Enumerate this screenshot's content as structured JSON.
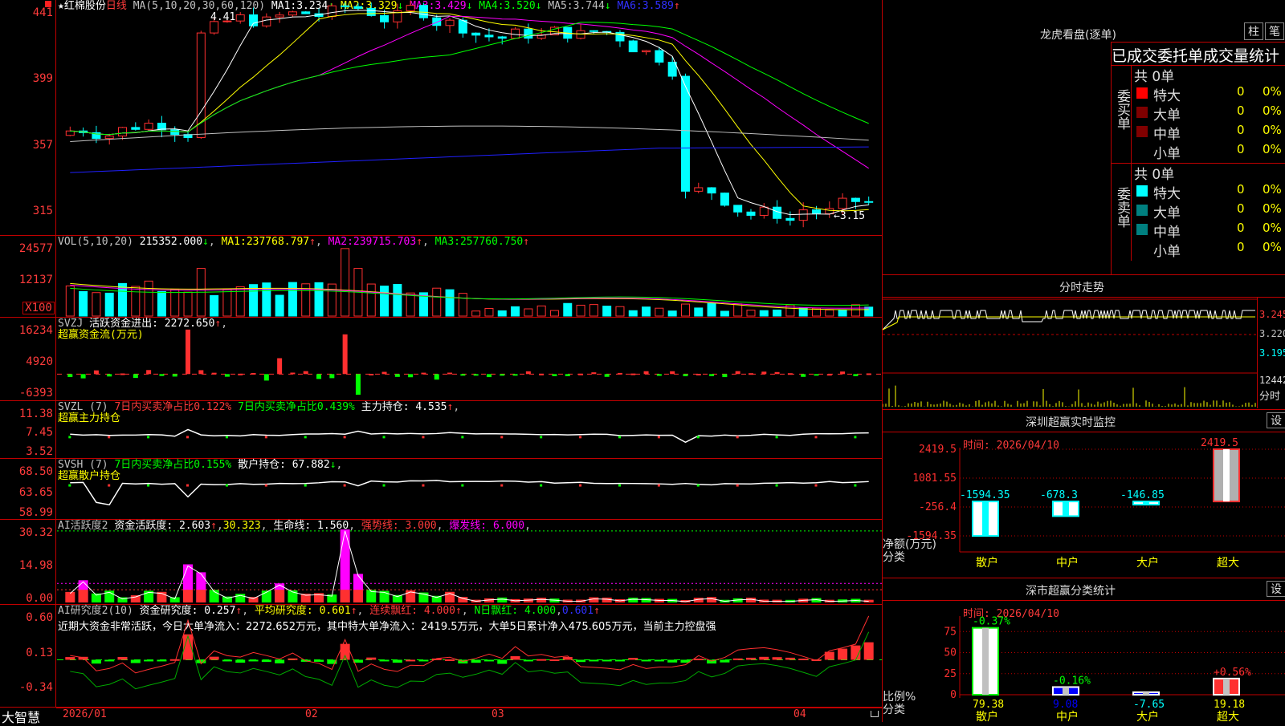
{
  "stock": {
    "star": "★",
    "name": "红棉股份",
    "period": "日线"
  },
  "kline": {
    "ma_label": "MA(5,10,20,30,60,120)",
    "ma": [
      {
        "label": "MA1:",
        "value": "3.234",
        "dir": "↓",
        "color": "#ffffff"
      },
      {
        "label": "MA2:",
        "value": "3.329",
        "dir": "↓",
        "color": "#ffff00"
      },
      {
        "label": "MA3:",
        "value": "3.429",
        "dir": "↓",
        "color": "#ff00ff"
      },
      {
        "label": "MA4:",
        "value": "3.520",
        "dir": "↓",
        "color": "#00ff00"
      },
      {
        "label": "MA5:",
        "value": "3.744",
        "dir": "↓",
        "color": "#c0c0c0"
      },
      {
        "label": "MA6:",
        "value": "3.589",
        "dir": "↑",
        "color": "#2020ff"
      }
    ],
    "y_ticks": [
      "441",
      "399",
      "357",
      "315"
    ],
    "high_label": "4.41",
    "low_label": "←3.15"
  },
  "volume": {
    "label": "VOL(5,10,20)",
    "value": "215352.000",
    "value_dir": "↓",
    "ma": [
      {
        "label": "MA1:",
        "value": "237768.797",
        "dir": "↑",
        "color": "#ffff00"
      },
      {
        "label": "MA2:",
        "value": "239715.703",
        "dir": "↑",
        "color": "#ff00ff"
      },
      {
        "label": "MA3:",
        "value": "257760.750",
        "dir": "↑",
        "color": "#00ff00"
      }
    ],
    "y_ticks": [
      "24577",
      "12137"
    ],
    "unit": "X100"
  },
  "svzj": {
    "label": "SVZJ",
    "title": "活跃资金进出:",
    "value": "2272.650",
    "dir": "↑",
    "subtitle": "超赢资金流(万元)",
    "y_ticks": [
      "16234",
      "4920",
      "-6393"
    ]
  },
  "svzl": {
    "label": "SVZL (7)",
    "t1": "7日内买卖净占比0.122%",
    "t2": "7日内买卖净占比0.439%",
    "t3": "主力持仓:",
    "value": "4.535",
    "dir": "↑",
    "subtitle": "超赢主力持仓",
    "y_ticks": [
      "11.38",
      "7.45",
      "3.52"
    ]
  },
  "svsh": {
    "label": "SVSH (7)",
    "t1": "7日内买卖净占比0.155%",
    "t2": "散户持仓:",
    "value": "67.882",
    "dir": "↓",
    "subtitle": "超赢散户持仓",
    "y_ticks": [
      "68.50",
      "63.65",
      "58.99"
    ]
  },
  "ai_act": {
    "label": "AI活跃度2",
    "t1": "资金活跃度:",
    "v1": "2.603",
    "v2": "30.323",
    "t3": "生命线:",
    "v3": "1.560",
    "t4": "强势线:",
    "v4": "3.000",
    "t5": "爆发线:",
    "v5": "6.000",
    "y_ticks": [
      "30.32",
      "14.98",
      "0.00"
    ]
  },
  "ai_res": {
    "label": "AI研究度2(10)",
    "t1": "资金研究度:",
    "v1": "0.257",
    "t2": "平均研究度:",
    "v2": "0.601",
    "t3": "连续飘红:",
    "v3": "4.000",
    "t4": "N日飘红:",
    "v4": "4.000",
    "v5": "0.601",
    "note": "近期大资金非常活跃，今日大单净流入：2272.652万元，其中特大单净流入：2419.5万元，大单5日累计净入475.605万元，当前主力控盘强",
    "y_ticks": [
      "0.60",
      "0.13",
      "-0.34"
    ]
  },
  "x_axis": {
    "labels": [
      "2026/01",
      "02",
      "03",
      "04"
    ]
  },
  "brand": "大智慧",
  "panel_lhb": {
    "title": "龙虎看盘(逐单)",
    "btn1": "柱",
    "btn2": "笔",
    "stat_title": "已成交委托单成交量统计",
    "buy": {
      "side": "委买单",
      "total": "共 0单",
      "rows": [
        {
          "name": "特大",
          "n": "0",
          "pct": "0%",
          "color": "#ff0000"
        },
        {
          "name": "大单",
          "n": "0",
          "pct": "0%",
          "color": "#800000"
        },
        {
          "name": "中单",
          "n": "0",
          "pct": "0%",
          "color": "#800000"
        },
        {
          "name": "小单",
          "n": "0",
          "pct": "0%",
          "color": ""
        }
      ]
    },
    "sell": {
      "side": "委卖单",
      "total": "共 0单",
      "rows": [
        {
          "name": "特大",
          "n": "0",
          "pct": "0%",
          "color": "#00ffff"
        },
        {
          "name": "大单",
          "n": "0",
          "pct": "0%",
          "color": "#008080"
        },
        {
          "name": "中单",
          "n": "0",
          "pct": "0%",
          "color": "#008080"
        },
        {
          "name": "小单",
          "n": "0",
          "pct": "0%",
          "color": ""
        }
      ]
    }
  },
  "panel_fs": {
    "title": "分时走势",
    "y_ticks": [
      "3.245",
      "3.220",
      "3.195"
    ],
    "vol_label": "12442",
    "vol_unit": "分时"
  },
  "panel_monitor": {
    "title": "深圳超赢实时监控",
    "btn": "设",
    "time": "时间: 2026/04/10",
    "y_ticks": [
      "2419.5",
      "1081.55",
      "-256.4",
      "-1594.35"
    ],
    "ylabel": "净额(万元)",
    "xlabel": "分类",
    "categories": [
      "散户",
      "中户",
      "大户",
      "超大"
    ],
    "value_labels": [
      "-1594.35",
      "-678.3",
      "-146.85",
      "2419.5"
    ]
  },
  "panel_class": {
    "title": "深市超赢分类统计",
    "btn": "设",
    "time": "时间: 2026/04/10",
    "y_ticks": [
      "75",
      "50",
      "25",
      "0"
    ],
    "ylabel": "比例%",
    "xlabel": "分类",
    "categories": [
      "散户",
      "中户",
      "大户",
      "超大"
    ],
    "top_labels": [
      "-0.37%",
      "-0.16%",
      "",
      "+0.56%"
    ],
    "bottom_labels": [
      "79.38",
      "9.08",
      "-7.65",
      "19.18"
    ]
  },
  "chart_data": {
    "type": "bar",
    "title": "深圳超赢实时监控",
    "categories": [
      "散户",
      "中户",
      "大户",
      "超大"
    ],
    "values": [
      -1594.35,
      -678.3,
      -146.85,
      2419.5
    ],
    "ylabel": "净额(万元)",
    "ylim": [
      -1594.35,
      2419.5
    ]
  }
}
